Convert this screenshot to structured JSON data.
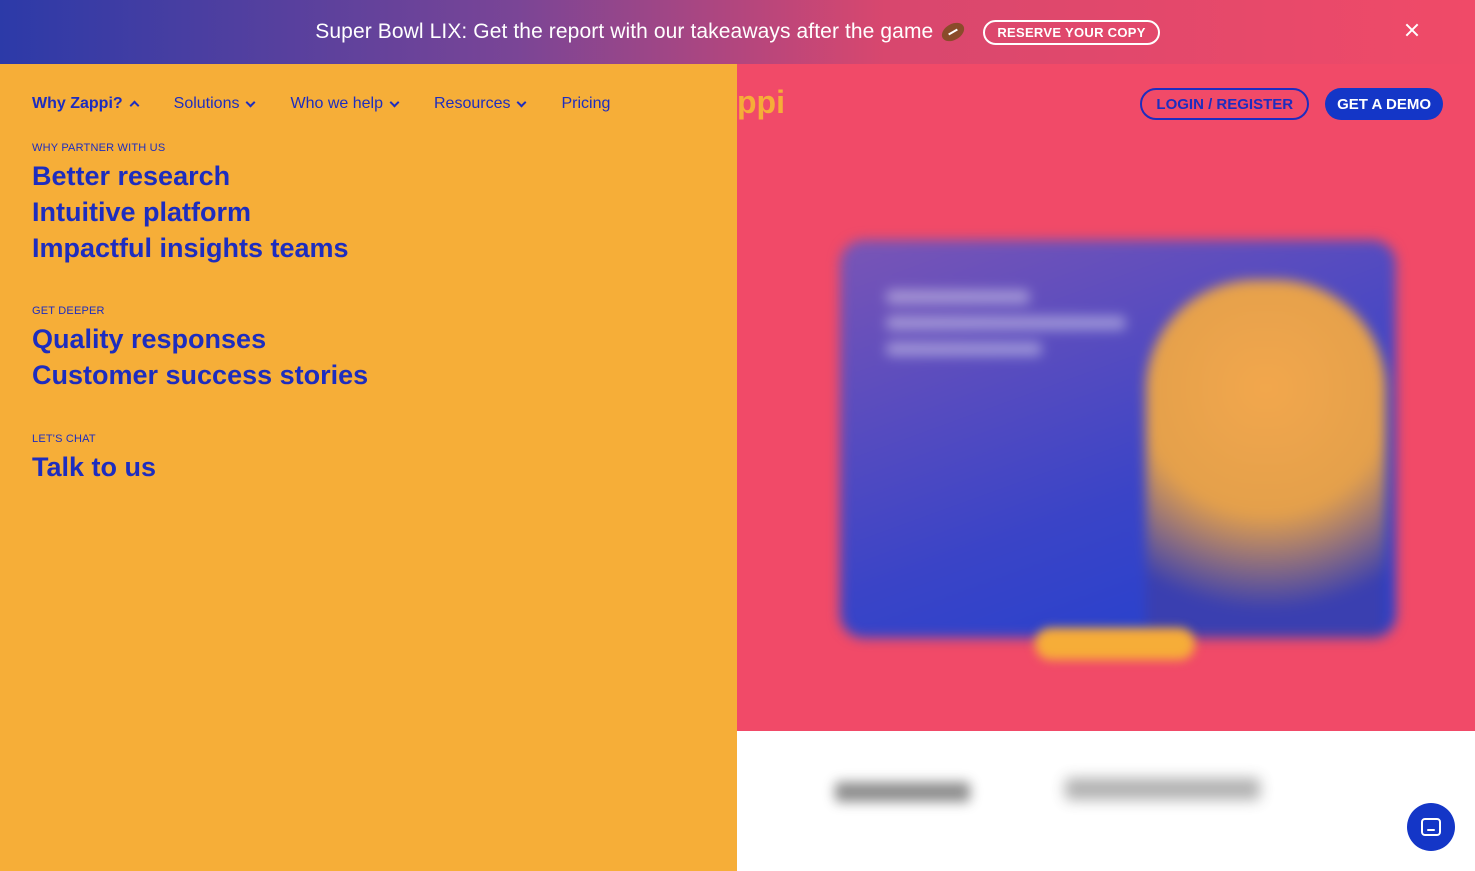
{
  "announcement": {
    "text": "Super Bowl LIX: Get the report with our takeaways after the game",
    "cta_label": "RESERVE YOUR COPY"
  },
  "header": {
    "logo_fragment": "ppi",
    "login_label": "LOGIN / REGISTER",
    "demo_label": "GET A DEMO"
  },
  "nav": {
    "items": [
      {
        "label": "Why Zappi?"
      },
      {
        "label": "Solutions"
      },
      {
        "label": "Who we help"
      },
      {
        "label": "Resources"
      },
      {
        "label": "Pricing"
      }
    ]
  },
  "menu": {
    "sections": [
      {
        "label": "WHY PARTNER WITH US",
        "links": [
          "Better research",
          "Intuitive platform",
          "Impactful insights teams"
        ]
      },
      {
        "label": "GET DEEPER",
        "links": [
          "Quality responses",
          "Customer success stories"
        ]
      },
      {
        "label": "LET'S CHAT",
        "links": [
          "Talk to us"
        ]
      }
    ]
  },
  "colors": {
    "menu_bg": "#f6ae38",
    "primary_blue": "#1d2dbf",
    "hero_pink": "#f14a68"
  }
}
